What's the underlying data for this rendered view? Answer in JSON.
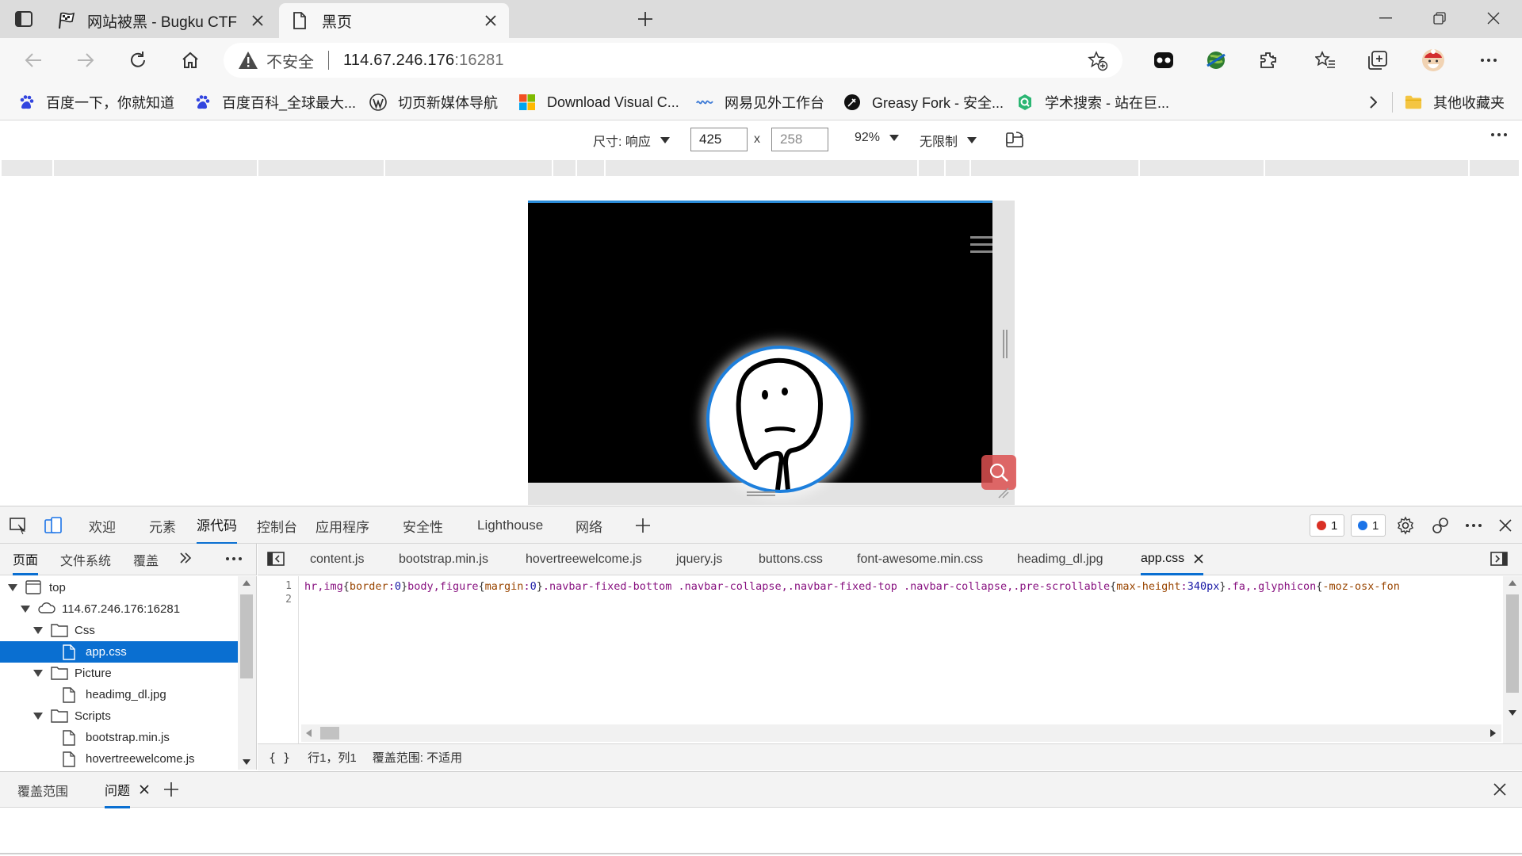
{
  "tabs": [
    {
      "title": "网站被黑 - Bugku CTF",
      "active": false
    },
    {
      "title": "黑页",
      "active": true
    }
  ],
  "address": {
    "security_label": "不安全",
    "url_host": "114.67.246.176",
    "url_port": ":16281"
  },
  "bookmarks": [
    {
      "label": "百度一下，你就知道",
      "icon": "baidu-paw-icon"
    },
    {
      "label": "百度百科_全球最大...",
      "icon": "baidu-paw-icon"
    },
    {
      "label": "切页新媒体导航",
      "icon": "wordpress-icon"
    },
    {
      "label": "Download Visual C...",
      "icon": "microsoft-icon"
    },
    {
      "label": "网易见外工作台",
      "icon": "wave-icon"
    },
    {
      "label": "Greasy Fork - 安全...",
      "icon": "greasyfork-icon"
    },
    {
      "label": "学术搜索 - 站在巨...",
      "icon": "scholar-icon"
    }
  ],
  "other_bookmarks": "其他收藏夹",
  "device_toolbar": {
    "dimensions_label": "尺寸: 响应",
    "width": "425",
    "height_placeholder": "258",
    "times": "x",
    "zoom": "92%",
    "throttle": "无限制"
  },
  "devtools": {
    "main_tabs": [
      "欢迎",
      "元素",
      "源代码",
      "控制台",
      "应用程序",
      "安全性",
      "Lighthouse",
      "网络"
    ],
    "active_main_tab": "源代码",
    "error_count": "1",
    "info_count": "1",
    "navigator_tabs": [
      "页面",
      "文件系统",
      "覆盖"
    ],
    "tree": [
      {
        "label": "top",
        "level": 0,
        "kind": "frame",
        "expanded": true
      },
      {
        "label": "114.67.246.176:16281",
        "level": 1,
        "kind": "cloud",
        "expanded": true
      },
      {
        "label": "Css",
        "level": 2,
        "kind": "folder",
        "expanded": true
      },
      {
        "label": "app.css",
        "level": 3,
        "kind": "file",
        "selected": true
      },
      {
        "label": "Picture",
        "level": 2,
        "kind": "folder",
        "expanded": true
      },
      {
        "label": "headimg_dl.jpg",
        "level": 3,
        "kind": "file"
      },
      {
        "label": "Scripts",
        "level": 2,
        "kind": "folder",
        "expanded": true
      },
      {
        "label": "bootstrap.min.js",
        "level": 3,
        "kind": "file"
      },
      {
        "label": "hovertreewelcome.js",
        "level": 3,
        "kind": "file"
      }
    ],
    "editor_tabs": [
      "content.js",
      "bootstrap.min.js",
      "hovertreewelcome.js",
      "jquery.js",
      "buttons.css",
      "font-awesome.min.css",
      "headimg_dl.jpg",
      "app.css"
    ],
    "active_editor_tab": "app.css",
    "line_numbers": [
      "1",
      "2"
    ],
    "code_line_1": "hr,img{border:0}body,figure{margin:0}.navbar-fixed-bottom .navbar-collapse,.navbar-fixed-top .navbar-collapse,.pre-scrollable{max-height:340px}.fa,.glyphicon{-moz-osx-fon",
    "status": {
      "braces": "{ }",
      "position": "行1，列1",
      "coverage": "覆盖范围: 不适用"
    },
    "drawer_tabs": [
      "覆盖范围",
      "问题"
    ],
    "active_drawer_tab": "问题"
  }
}
